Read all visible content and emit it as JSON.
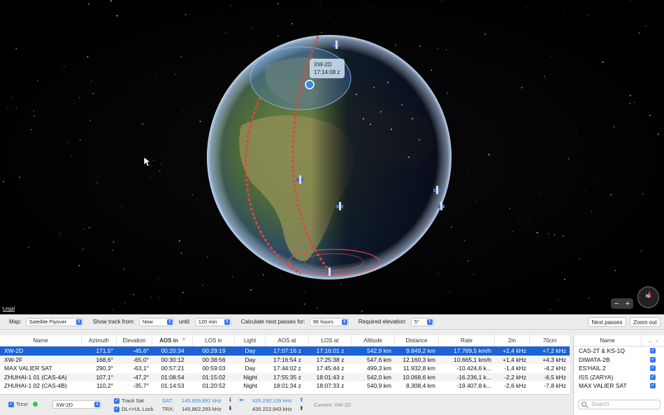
{
  "map": {
    "legal_label": "Legal",
    "tooltip_sat": "XW-2D",
    "tooltip_time": "17:14:08 z",
    "zoom_minus": "−",
    "zoom_plus": "+",
    "compass_label": "N"
  },
  "controls": {
    "map_label": "Map:",
    "map_value": "Satellite Flyover",
    "track_from_label": "Show track from:",
    "track_from_value": "Now",
    "until_label": "until:",
    "until_value": "120 min",
    "calc_label": "Calculate next passes for:",
    "calc_value": "96 hours",
    "elev_label": "Required elevation:",
    "elev_value": "5°",
    "next_passes_button": "Next passes",
    "zoom_out_button": "Zoom out"
  },
  "table": {
    "headers": [
      "Name",
      "Azimuth",
      "Elevation",
      "AOS in",
      "LOS in",
      "Light",
      "AOS at",
      "LOS at",
      "Altitude",
      "Distance",
      "Rate",
      "2m",
      "70cm"
    ],
    "sort_indicator": "^",
    "rows": [
      [
        "XW-2D",
        "171,5°",
        "-45,6°",
        "00:20:34",
        "00:29:19",
        "Day",
        "17:07:16 z",
        "17:16:01 z",
        "542,9 km",
        "9.849,2 km",
        "17.769,5 km/h",
        "+2,4 kHz",
        "+7,2 kHz"
      ],
      [
        "XW-2F",
        "168,6°",
        "-65,0°",
        "00:30:12",
        "00:38:56",
        "Day",
        "17:16:54 z",
        "17:25:38 z",
        "547,6 km",
        "12.160,3 km",
        "10.665,1 km/h",
        "+1,4 kHz",
        "+4,3 kHz"
      ],
      [
        "MAX VALIER SAT",
        "290,3°",
        "-63,1°",
        "00:57:21",
        "00:59:03",
        "Day",
        "17:44:02 z",
        "17:45:44 z",
        "499,3 km",
        "11.932,8 km",
        "-10.424,6 k...",
        "-1,4 kHz",
        "-4,2 kHz"
      ],
      [
        "ZHUHAI-1 01 (CAS-4A)",
        "107,1°",
        "-47,2°",
        "01:08:54",
        "01:15:02",
        "Night",
        "17:55:35 z",
        "18:01:43 z",
        "542,0 km",
        "10.068,6 km",
        "-16.236,1 k...",
        "-2,2 kHz",
        "-6,5 kHz"
      ],
      [
        "ZHUHAI-1 02 (CAS-4B)",
        "110,2°",
        "-35,7°",
        "01:14:53",
        "01:20:52",
        "Night",
        "18:01:34 z",
        "18:07:33 z",
        "540,9 km",
        "8.308,4 km",
        "-19.407,8 k...",
        "-2,6 kHz",
        "-7,8 kHz"
      ]
    ]
  },
  "bottom": {
    "trcvr_label": "Trcvr",
    "trcvr_value": "XW-2D",
    "track_sat_label": "Track Sat",
    "dl_ul_label": "DL<>UL Lock",
    "sat_label": "SAT:",
    "sat_dl": "145.859,891 kHz",
    "sat_ul": "435.230,109 kHz",
    "trx_label": "TRX:",
    "trx_dl": "145.862,293 kHz",
    "trx_ul": "435.222,943 kHz",
    "current_label": "Current: XW-2D"
  },
  "right_panel": {
    "header": "Name",
    "header_more": "...",
    "items": [
      "CAS-2T & KS-1Q",
      "DIWATA-2B",
      "ES'HAIL 2",
      "ISS (ZARYA)",
      "MAX VALIER SAT"
    ],
    "search_placeholder": "Search"
  },
  "colors": {
    "selection": "#1b62d6",
    "accent": "#3478f6",
    "track": "#e0453a"
  }
}
